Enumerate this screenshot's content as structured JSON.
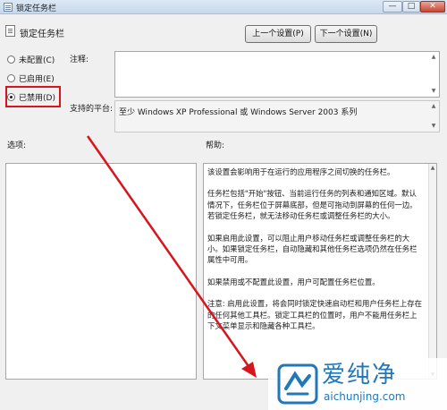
{
  "window": {
    "title": "锁定任务栏",
    "minimize_glyph": "—",
    "maximize_glyph": "□",
    "close_glyph": "✕"
  },
  "header": {
    "policy_title": "锁定任务栏",
    "prev_button": "上一个设置(P)",
    "next_button": "下一个设置(N)"
  },
  "radios": [
    {
      "label": "未配置(C)",
      "checked": false
    },
    {
      "label": "已启用(E)",
      "checked": false
    },
    {
      "label": "已禁用(D)",
      "checked": true
    }
  ],
  "comment": {
    "label": "注释:",
    "value": ""
  },
  "platform": {
    "label": "支持的平台:",
    "value": "至少 Windows XP Professional 或 Windows Server 2003 系列"
  },
  "options": {
    "label": "选项:"
  },
  "help": {
    "label": "帮助:",
    "paragraphs": [
      "该设置会影响用于在运行的应用程序之间切换的任务栏。",
      "任务栏包括\"开始\"按钮、当前运行任务的列表和通知区域。默认情况下，任务栏位于屏幕底部，但是可拖动到屏幕的任何一边。若锁定任务栏，就无法移动任务栏或调整任务栏的大小。",
      "如果启用此设置，可以阻止用户移动任务栏或调整任务栏的大小。如果锁定任务栏，自动隐藏和其他任务栏选项仍然在任务栏属性中可用。",
      "如果禁用或不配置此设置，用户可配置任务栏位置。",
      "注意: 启用此设置，将会同时锁定快速启动栏和用户任务栏上存在的任何其他工具栏。锁定工具栏的位置时，用户不能用任务栏上下文菜单显示和隐藏各种工具栏。"
    ]
  },
  "watermark": {
    "brand": "爱纯净",
    "url": "aichunjing.com"
  },
  "colors": {
    "highlight": "#d8141c",
    "arrow": "#d8141c",
    "watermark": "#2178b8"
  }
}
